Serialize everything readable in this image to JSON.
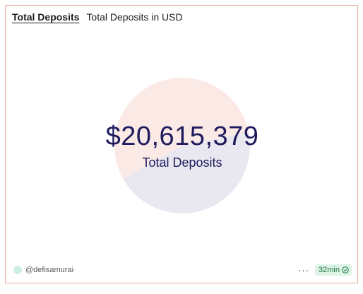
{
  "header": {
    "title": "Total Deposits",
    "subtitle": "Total Deposits in USD"
  },
  "counter": {
    "value": "$20,615,379",
    "label": "Total Deposits"
  },
  "chart_data": {
    "type": "pie",
    "slices": [
      {
        "fraction": 0.55,
        "color": "#fbe9e5"
      },
      {
        "fraction": 0.45,
        "color": "#e9e7ef"
      }
    ]
  },
  "footer": {
    "author": "@defisamurai",
    "more_label": "···",
    "refresh_age": "32min"
  },
  "colors": {
    "border": "#e8a99a",
    "value_text": "#1e1b5e",
    "badge_bg": "#ddf3e6",
    "badge_text": "#1f7a45"
  },
  "icons": {
    "status": "check-circle-icon",
    "avatar": "avatar"
  }
}
